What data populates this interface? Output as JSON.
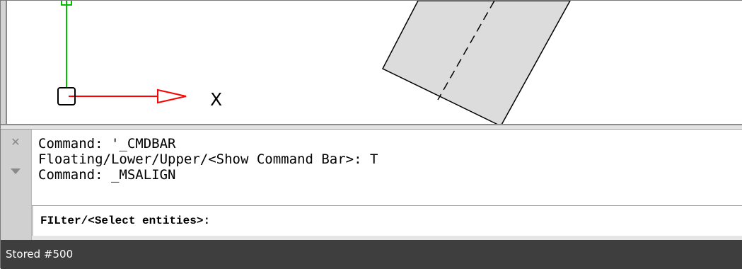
{
  "viewport": {
    "ucs_axis_label": "X",
    "colors": {
      "x_axis": "#ff0000",
      "y_axis": "#00c000",
      "shape_fill": "#dcdcdc",
      "shape_stroke": "#000000"
    }
  },
  "command_window": {
    "close_icon": "close-icon",
    "collapse_icon": "triangle-down-icon",
    "history": [
      "Command: '_CMDBAR",
      "Floating/Lower/Upper/<Show Command Bar>: T",
      "Command: _MSALIGN"
    ],
    "prompt": "FILter/<Select entities>:"
  },
  "status_bar": {
    "text": "Stored #500"
  }
}
